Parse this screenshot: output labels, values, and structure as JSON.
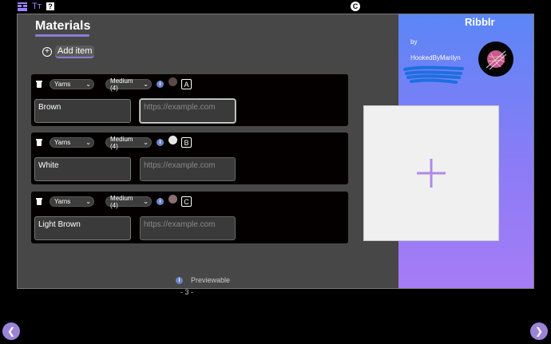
{
  "toolbar": {
    "icons": [
      "layout-icon",
      "text-size-icon",
      "help-icon"
    ],
    "help_label": "?",
    "text_size_label": "Tт",
    "center_icon_label": "C"
  },
  "materials": {
    "title": "Materials",
    "add_item_label": "Add item",
    "items": [
      {
        "type": "Yarns",
        "weight": "Medium (4)",
        "swatch_color": "#5a4a4a",
        "letter": "A",
        "name": "Brown",
        "url_placeholder": "https://example.com",
        "focused": true
      },
      {
        "type": "Yarns",
        "weight": "Medium (4)",
        "swatch_color": "#e6e6e6",
        "letter": "B",
        "name": "White",
        "url_placeholder": "https://example.com",
        "focused": false
      },
      {
        "type": "Yarns",
        "weight": "Medium (4)",
        "swatch_color": "#8a7070",
        "letter": "C",
        "name": "Light Brown",
        "url_placeholder": "https://example.com",
        "focused": false
      }
    ],
    "footer_label": "Previewable"
  },
  "page_number": "- 3 -",
  "sidebar": {
    "brand": "Ribblr",
    "by_label": "by",
    "author": "HookedByMarilyn"
  },
  "colors": {
    "accent": "#8e7bd6",
    "gradient_top": "#5b86f6",
    "gradient_bottom": "#a57cf6"
  }
}
